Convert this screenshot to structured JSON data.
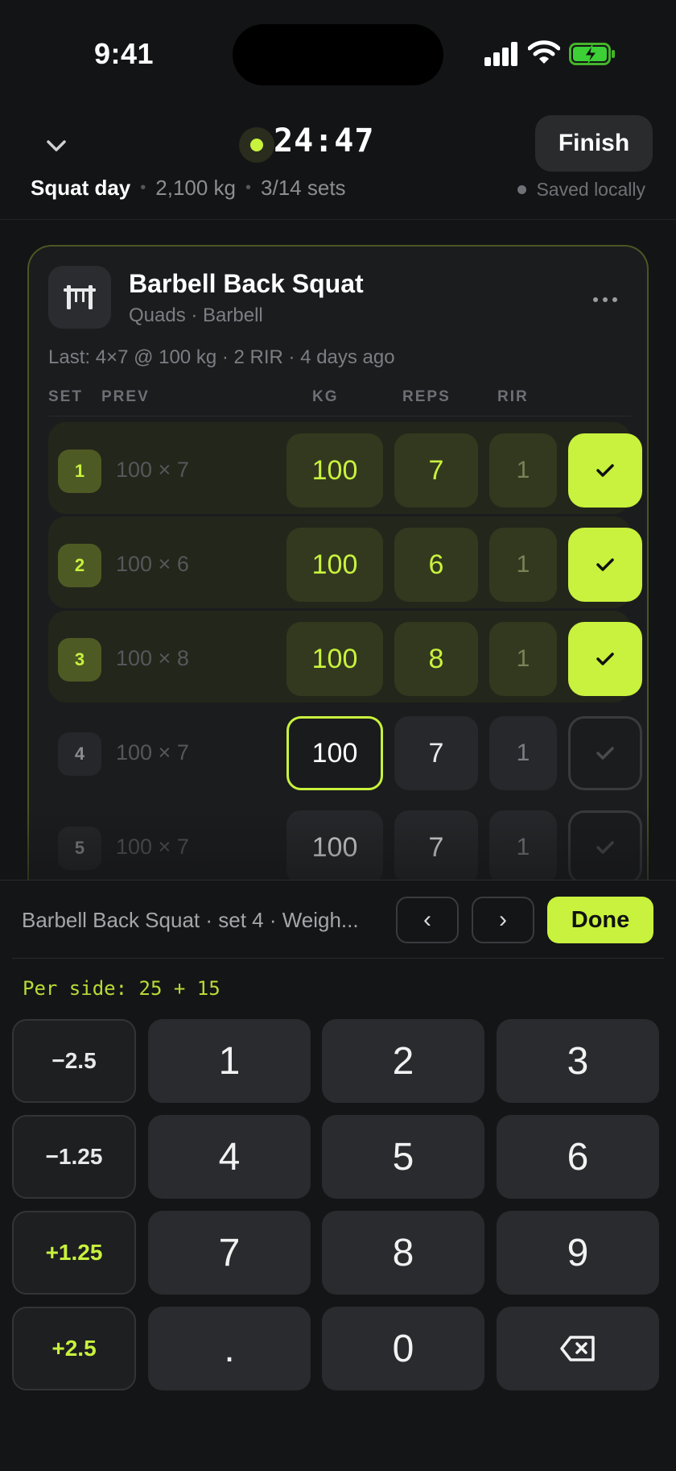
{
  "status_bar": {
    "time": "9:41"
  },
  "header": {
    "timer": "24:47",
    "finish_label": "Finish",
    "workout_title": "Squat day",
    "total_volume": "2,100 kg",
    "sets_progress": "3/14 sets",
    "sets_done": 3,
    "sets_total": 14,
    "save_status": "Saved locally"
  },
  "exercise": {
    "name": "Barbell Back Squat",
    "meta": "Quads · Barbell",
    "last_session": "Last: 4×7 @ 100 kg · 2 RIR · 4 days ago",
    "columns": {
      "set": "SET",
      "prev": "PREV",
      "kg": "KG",
      "reps": "REPS",
      "rir": "RIR"
    },
    "sets": [
      {
        "num": "1",
        "prev": "100 × 7",
        "kg": "100",
        "reps": "7",
        "rir": "1",
        "completed": true
      },
      {
        "num": "2",
        "prev": "100 × 6",
        "kg": "100",
        "reps": "6",
        "rir": "1",
        "completed": true
      },
      {
        "num": "3",
        "prev": "100 × 8",
        "kg": "100",
        "reps": "8",
        "rir": "1",
        "completed": true
      },
      {
        "num": "4",
        "prev": "100 × 7",
        "kg": "100",
        "reps": "7",
        "rir": "1",
        "completed": false,
        "editing": "kg"
      },
      {
        "num": "5",
        "prev": "100 × 7",
        "kg": "100",
        "reps": "7",
        "rir": "1",
        "completed": false
      }
    ]
  },
  "keypad": {
    "context_label": "Barbell Back Squat · set 4 · Weigh...",
    "prev_label": "‹",
    "next_label": "›",
    "done_label": "Done",
    "per_side": "Per side: 25 + 15",
    "steps": [
      "−2.5",
      "−1.25",
      "+1.25",
      "+2.5"
    ],
    "keys": [
      "1",
      "2",
      "3",
      "4",
      "5",
      "6",
      "7",
      "8",
      "9",
      ".",
      "0"
    ]
  },
  "colors": {
    "accent": "#c8f23d",
    "background": "#131415",
    "card": "#1b1c1e",
    "key": "#2a2b2e"
  }
}
